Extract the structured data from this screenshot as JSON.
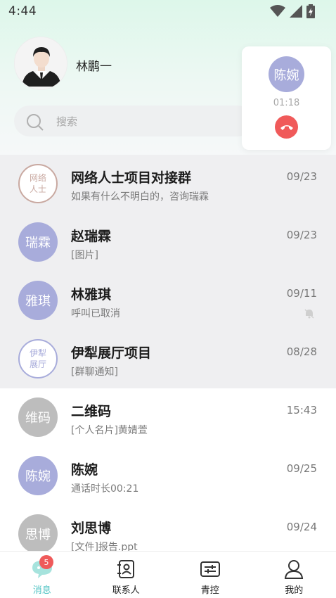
{
  "status_bar": {
    "time": "4:44"
  },
  "profile": {
    "name": "林鹏一"
  },
  "search": {
    "placeholder": "搜索"
  },
  "call_popup": {
    "avatar_text": "陈婉",
    "timer": "01:18"
  },
  "chats": [
    {
      "avatar_text": "网络\n人士",
      "avatar_style": "group",
      "avatar_color": "#c9a9a1",
      "name": "网络人士项目对接群",
      "preview": "如果有什么不明白的，咨询瑞霖",
      "time": "09/23",
      "pinned": true,
      "muted": false
    },
    {
      "avatar_text": "瑞霖",
      "avatar_style": "solid",
      "avatar_color": "#a8acdb",
      "name": "赵瑞霖",
      "preview": "[图片]",
      "time": "09/23",
      "pinned": true,
      "muted": false
    },
    {
      "avatar_text": "雅琪",
      "avatar_style": "solid",
      "avatar_color": "#a8acdb",
      "name": "林雅琪",
      "preview": "呼叫已取消",
      "time": "09/11",
      "pinned": true,
      "muted": true
    },
    {
      "avatar_text": "伊犁\n展厅",
      "avatar_style": "group",
      "avatar_color": "#a8acdb",
      "name": "伊犁展厅项目",
      "preview": "[群聊通知]",
      "time": "08/28",
      "pinned": true,
      "muted": false
    },
    {
      "avatar_text": "维码",
      "avatar_style": "solid",
      "avatar_color": "#bdbdbd",
      "name": "二维码",
      "preview": "[个人名片]黄婧萱",
      "time": "15:43",
      "pinned": false,
      "muted": false
    },
    {
      "avatar_text": "陈婉",
      "avatar_style": "solid",
      "avatar_color": "#a8acdb",
      "name": "陈婉",
      "preview": "通话时长00:21",
      "time": "09/25",
      "pinned": false,
      "muted": false
    },
    {
      "avatar_text": "思博",
      "avatar_style": "solid",
      "avatar_color": "#bdbdbd",
      "name": "刘思博",
      "preview": "[文件]报告.ppt",
      "time": "09/24",
      "pinned": false,
      "muted": false
    }
  ],
  "bottom_nav": {
    "items": [
      {
        "label": "消息",
        "icon": "message-icon",
        "active": true,
        "badge": "5"
      },
      {
        "label": "联系人",
        "icon": "contacts-icon",
        "active": false
      },
      {
        "label": "青控",
        "icon": "control-icon",
        "active": false
      },
      {
        "label": "我的",
        "icon": "profile-icon",
        "active": false
      }
    ]
  },
  "colors": {
    "accent": "#4fc3c3",
    "hangup": "#f05a5a",
    "badge": "#ef5a5a",
    "avatar_purple": "#a8acdb",
    "avatar_gray": "#bdbdbd"
  }
}
